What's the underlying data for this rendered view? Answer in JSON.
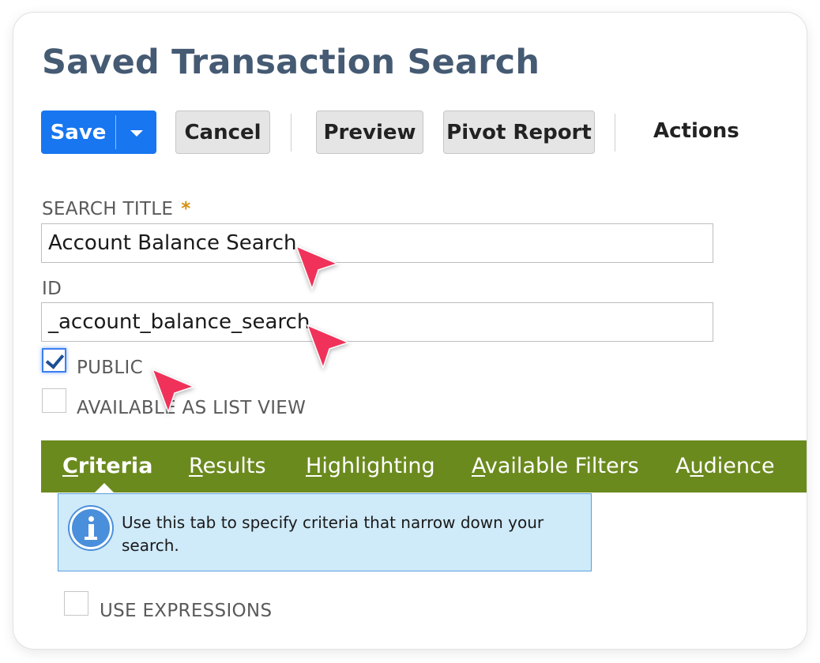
{
  "page": {
    "title": "Saved Transaction Search"
  },
  "toolbar": {
    "save_label": "Save",
    "cancel_label": "Cancel",
    "preview_label": "Preview",
    "pivot_report_label": "Pivot Report",
    "actions_label": "Actions"
  },
  "form": {
    "search_title_label": "SEARCH TITLE",
    "required_marker": "*",
    "search_title_value": "Account Balance Search",
    "id_label": "ID",
    "id_value": "_account_balance_search",
    "public_label": "PUBLIC",
    "public_checked": true,
    "available_list_view_label": "AVAILABLE AS LIST VIEW",
    "available_list_view_checked": false
  },
  "tabs": [
    {
      "first": "C",
      "rest": "riteria",
      "active": true
    },
    {
      "first": "R",
      "rest": "esults",
      "active": false
    },
    {
      "first": "H",
      "rest": "ighlighting",
      "active": false
    },
    {
      "first": "A",
      "rest": "vailable Filters",
      "active": false
    },
    {
      "pre": "A",
      "first": "u",
      "rest": "dience",
      "active": false
    }
  ],
  "info": {
    "icon": "info-icon",
    "text": "Use this tab to specify criteria that narrow down your search."
  },
  "criteria": {
    "use_expressions_label": "USE EXPRESSIONS",
    "use_expressions_checked": false
  },
  "colors": {
    "primary_button": "#1776f0",
    "title": "#455a73",
    "tab_bar": "#6b8a1e",
    "info_background": "#cfeaf9",
    "cursor": "#f0325a"
  }
}
